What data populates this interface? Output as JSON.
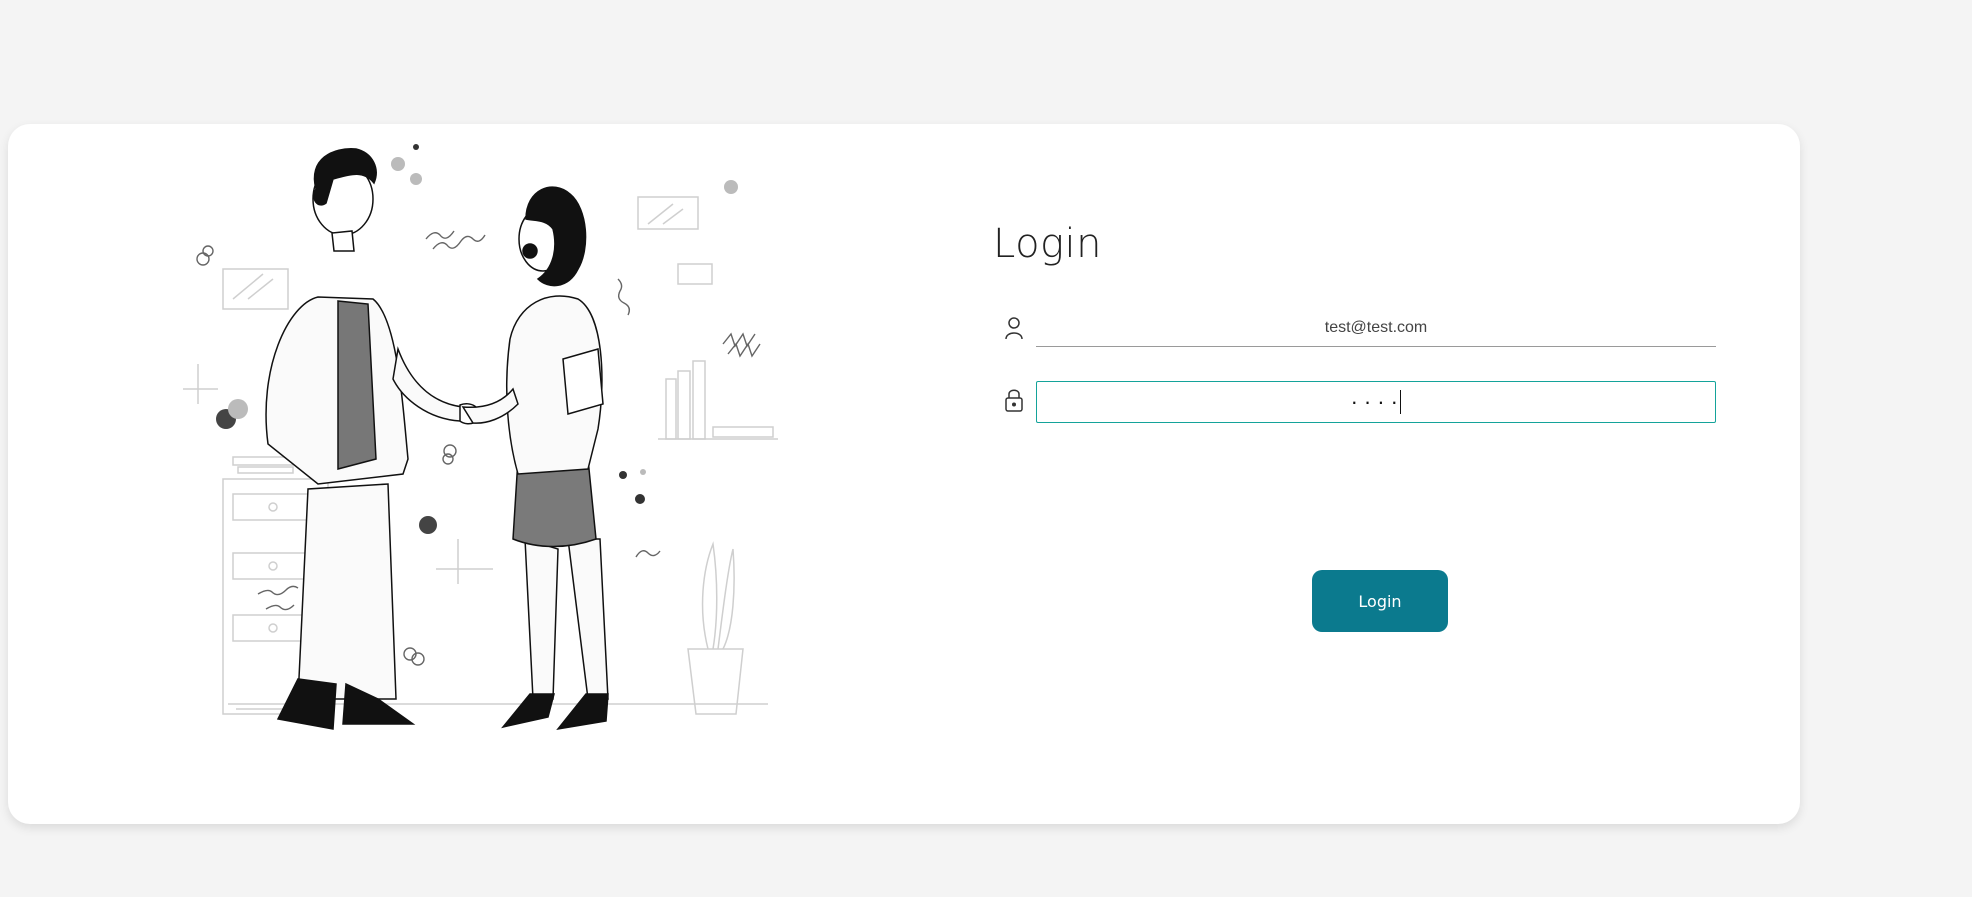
{
  "login": {
    "title": "Login",
    "email": {
      "icon": "user-icon",
      "value": "test@test.com"
    },
    "password": {
      "icon": "lock-icon",
      "value": "····"
    },
    "submit_label": "Login"
  },
  "colors": {
    "page_background": "#f4f4f4",
    "card_background": "#ffffff",
    "button": "#0b7a8e",
    "focus_border": "#14a39a"
  },
  "illustration": {
    "icon": "handshake-illustration"
  }
}
